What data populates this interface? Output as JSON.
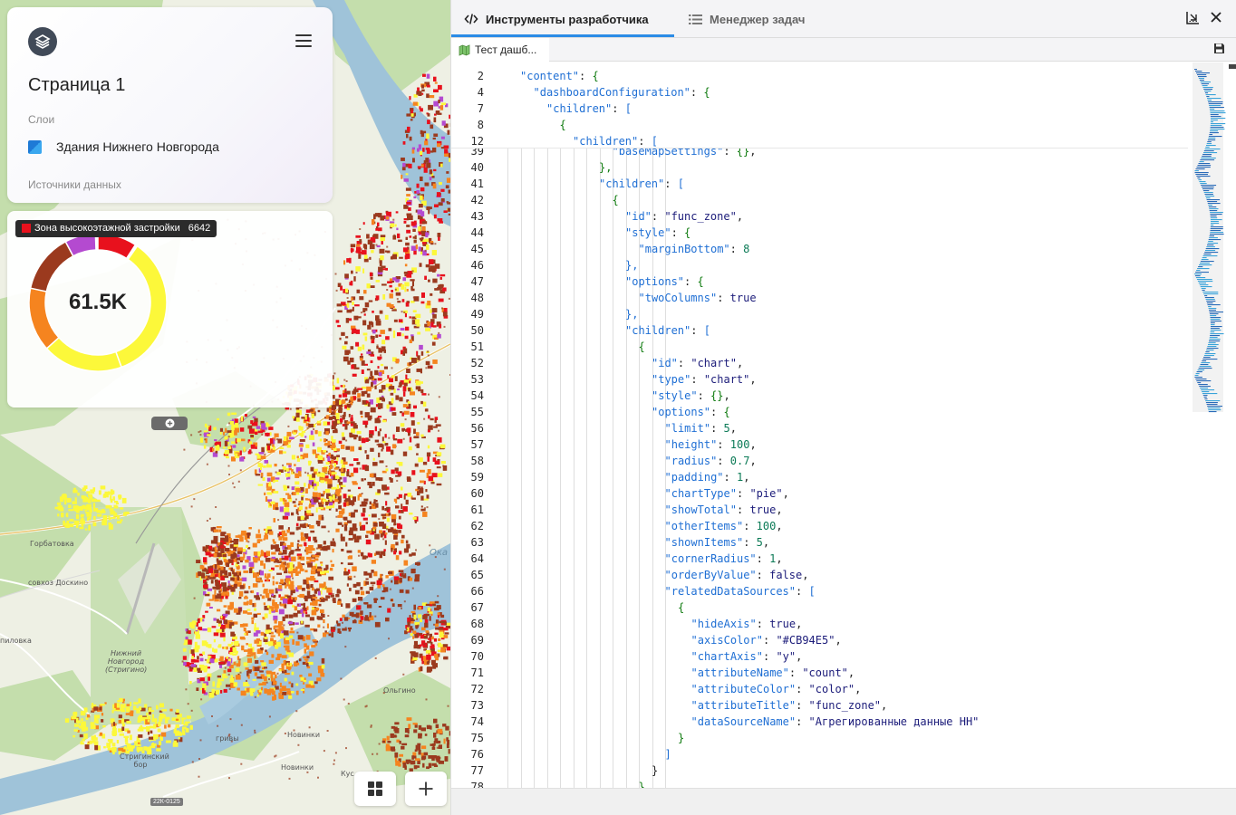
{
  "panel": {
    "page_title": "Страница 1",
    "layers_caption": "Слои",
    "layer_name": "Здания Нижнего Новгорода",
    "sources_caption": "Источники данных"
  },
  "widget": {
    "tooltip_label": "Зона высокоэтажной застройки",
    "tooltip_count": "6642",
    "total": "61.5K",
    "colors": {
      "yellow": "#fcf83a",
      "orange": "#f5841f",
      "brown": "#9b3a1e",
      "purple": "#b44ad0",
      "red": "#e8111d"
    },
    "slices": [
      {
        "label": "Зона высокоэтажной застройки",
        "value": 6642,
        "color": "#e8111d"
      }
    ]
  },
  "map": {
    "labels": {
      "gorbatovka": "Горбатовка",
      "doskino": "совхоз Доскино",
      "oka": "Ока",
      "olgino": "Ольгино",
      "novinki1": "Новинки",
      "novinki2": "Новинки",
      "kus": "Кус",
      "pilovka": "пиловка",
      "airport": "Нижний Новгород (Стригино)",
      "strigino": "Стригинский бор",
      "gribi": "гривы",
      "road": "22К-0125"
    }
  },
  "devtools": {
    "tab_devtools": "Инструменты разработчика",
    "tab_taskmanager": "Менеджер задач",
    "file_tab": "Тест дашб..."
  },
  "editor": {
    "sticky": [
      {
        "n": "2",
        "indent": 0,
        "key": "content",
        "open": "{"
      },
      {
        "n": "4",
        "indent": 1,
        "key": "dashboardConfiguration",
        "open": "{"
      },
      {
        "n": "7",
        "indent": 2,
        "key": "children",
        "open": "["
      },
      {
        "n": "8",
        "indent": 3,
        "key": null,
        "open": "{"
      },
      {
        "n": "12",
        "indent": 4,
        "key": "children",
        "open": "["
      }
    ],
    "lines": [
      {
        "n": "39",
        "indent": 7,
        "key": "baseMapSettings",
        "val": "{}",
        "vt": "b",
        "comma": ","
      },
      {
        "n": "40",
        "indent": 6,
        "raw": "},",
        "vt": "b"
      },
      {
        "n": "41",
        "indent": 6,
        "key": "children",
        "open": "["
      },
      {
        "n": "42",
        "indent": 7,
        "raw": "{",
        "vt": "b"
      },
      {
        "n": "43",
        "indent": 8,
        "key": "id",
        "val": "\"func_zone\"",
        "vt": "s",
        "comma": ","
      },
      {
        "n": "44",
        "indent": 8,
        "key": "style",
        "open": "{"
      },
      {
        "n": "45",
        "indent": 9,
        "key": "marginBottom",
        "val": "8",
        "vt": "num",
        "comma": ""
      },
      {
        "n": "46",
        "indent": 8,
        "raw": "},",
        "vt": "k"
      },
      {
        "n": "47",
        "indent": 8,
        "key": "options",
        "open": "{"
      },
      {
        "n": "48",
        "indent": 9,
        "key": "twoColumns",
        "val": "true",
        "vt": "s",
        "comma": ""
      },
      {
        "n": "49",
        "indent": 8,
        "raw": "},",
        "vt": "k"
      },
      {
        "n": "50",
        "indent": 8,
        "key": "children",
        "open": "["
      },
      {
        "n": "51",
        "indent": 9,
        "raw": "{",
        "vt": "b"
      },
      {
        "n": "52",
        "indent": 10,
        "key": "id",
        "val": "\"chart\"",
        "vt": "s",
        "comma": ","
      },
      {
        "n": "53",
        "indent": 10,
        "key": "type",
        "val": "\"chart\"",
        "vt": "s",
        "comma": ","
      },
      {
        "n": "54",
        "indent": 10,
        "key": "style",
        "val": "{}",
        "vt": "b",
        "comma": ","
      },
      {
        "n": "55",
        "indent": 10,
        "key": "options",
        "open": "{"
      },
      {
        "n": "56",
        "indent": 11,
        "key": "limit",
        "val": "5",
        "vt": "num",
        "comma": ","
      },
      {
        "n": "57",
        "indent": 11,
        "key": "height",
        "val": "100",
        "vt": "num",
        "comma": ","
      },
      {
        "n": "58",
        "indent": 11,
        "key": "radius",
        "val": "0.7",
        "vt": "num",
        "comma": ","
      },
      {
        "n": "59",
        "indent": 11,
        "key": "padding",
        "val": "1",
        "vt": "num",
        "comma": ","
      },
      {
        "n": "60",
        "indent": 11,
        "key": "chartType",
        "val": "\"pie\"",
        "vt": "s",
        "comma": ","
      },
      {
        "n": "61",
        "indent": 11,
        "key": "showTotal",
        "val": "true",
        "vt": "s",
        "comma": ","
      },
      {
        "n": "62",
        "indent": 11,
        "key": "otherItems",
        "val": "100",
        "vt": "num",
        "comma": ","
      },
      {
        "n": "63",
        "indent": 11,
        "key": "shownItems",
        "val": "5",
        "vt": "num",
        "comma": ","
      },
      {
        "n": "64",
        "indent": 11,
        "key": "cornerRadius",
        "val": "1",
        "vt": "num",
        "comma": ","
      },
      {
        "n": "65",
        "indent": 11,
        "key": "orderByValue",
        "val": "false",
        "vt": "s",
        "comma": ","
      },
      {
        "n": "66",
        "indent": 11,
        "key": "relatedDataSources",
        "open": "["
      },
      {
        "n": "67",
        "indent": 12,
        "raw": "{",
        "vt": "b"
      },
      {
        "n": "68",
        "indent": 13,
        "key": "hideAxis",
        "val": "true",
        "vt": "s",
        "comma": ","
      },
      {
        "n": "69",
        "indent": 13,
        "key": "axisColor",
        "val": "\"#CB94E5\"",
        "vt": "s",
        "comma": ","
      },
      {
        "n": "70",
        "indent": 13,
        "key": "chartAxis",
        "val": "\"y\"",
        "vt": "s",
        "comma": ","
      },
      {
        "n": "71",
        "indent": 13,
        "key": "attributeName",
        "val": "\"count\"",
        "vt": "s",
        "comma": ","
      },
      {
        "n": "72",
        "indent": 13,
        "key": "attributeColor",
        "val": "\"color\"",
        "vt": "s",
        "comma": ","
      },
      {
        "n": "73",
        "indent": 13,
        "key": "attributeTitle",
        "val": "\"func_zone\"",
        "vt": "s",
        "comma": ","
      },
      {
        "n": "74",
        "indent": 13,
        "key": "dataSourceName",
        "val": "\"Агрегированные данные НН\"",
        "vt": "s",
        "comma": ""
      },
      {
        "n": "75",
        "indent": 12,
        "raw": "}",
        "vt": "b"
      },
      {
        "n": "76",
        "indent": 11,
        "raw": "]",
        "vt": "k"
      },
      {
        "n": "77",
        "indent": 10,
        "raw": "}",
        "vt": "punc"
      },
      {
        "n": "78",
        "indent": 9,
        "raw": "}",
        "vt": "b"
      }
    ]
  }
}
